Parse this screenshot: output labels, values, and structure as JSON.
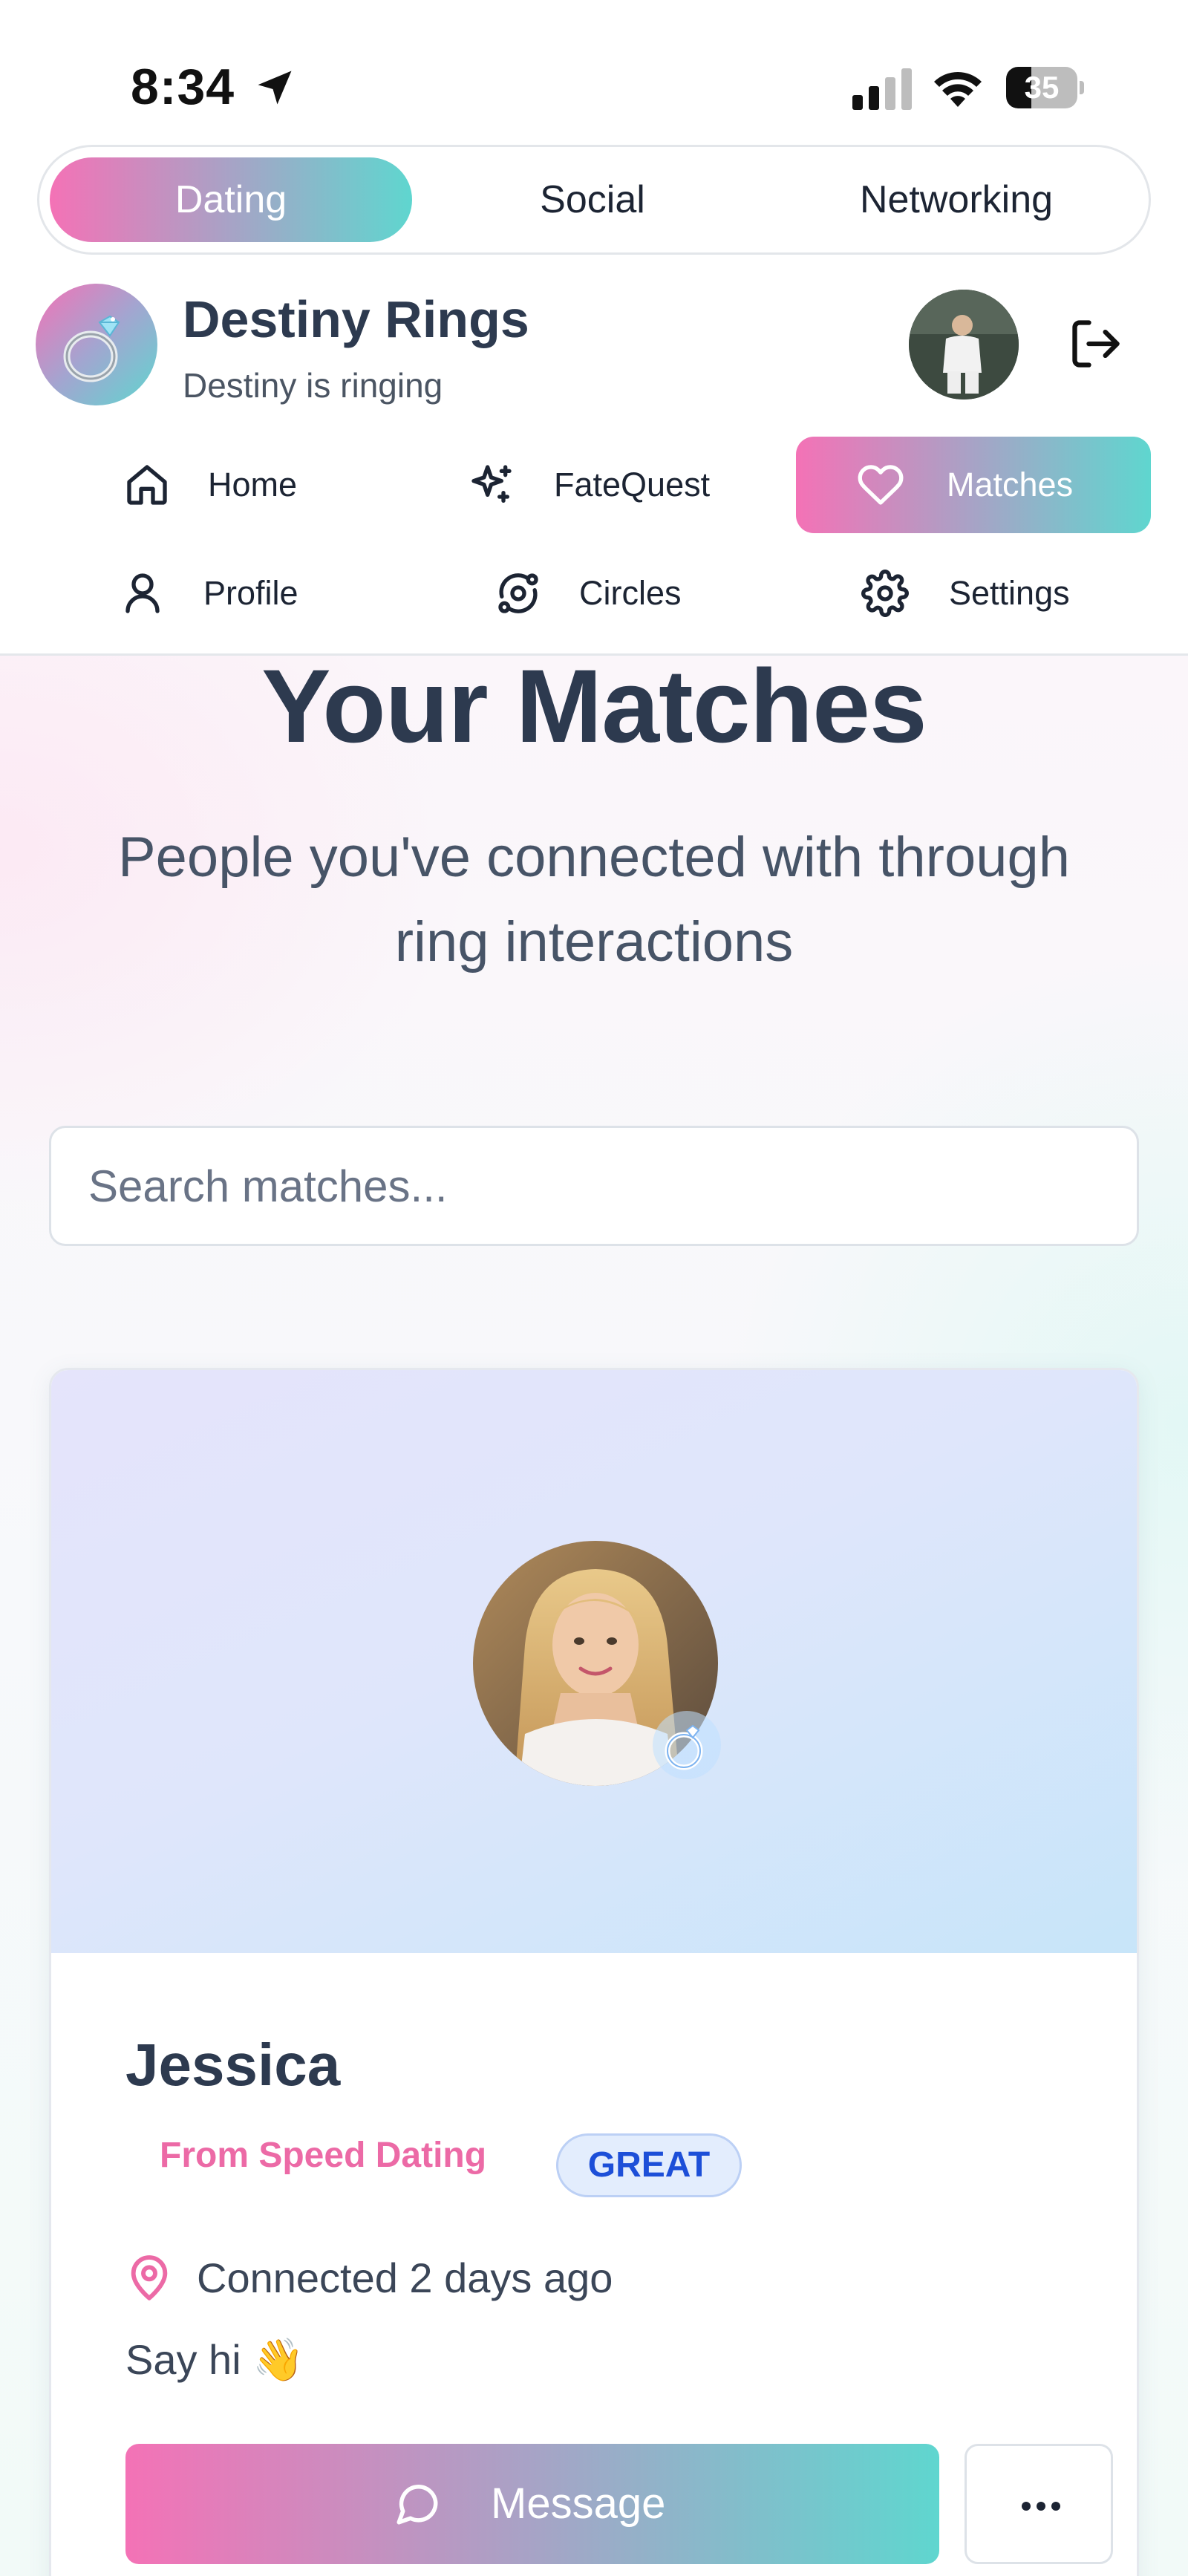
{
  "status_bar": {
    "time": "8:34",
    "battery": "35",
    "battery_level": 0.35
  },
  "mode_tabs": [
    {
      "label": "Dating",
      "active": true
    },
    {
      "label": "Social",
      "active": false
    },
    {
      "label": "Networking",
      "active": false
    }
  ],
  "app": {
    "title": "Destiny Rings",
    "subtitle": "Destiny is ringing",
    "logo_icon": "ring-icon",
    "logout_icon": "logout-icon"
  },
  "nav": [
    {
      "label": "Home",
      "icon": "home-icon",
      "active": false
    },
    {
      "label": "FateQuest",
      "icon": "sparkles-icon",
      "active": false
    },
    {
      "label": "Matches",
      "icon": "heart-icon",
      "active": true
    },
    {
      "label": "Profile",
      "icon": "user-icon",
      "active": false
    },
    {
      "label": "Circles",
      "icon": "orbit-icon",
      "active": false
    },
    {
      "label": "Settings",
      "icon": "gear-icon",
      "active": false
    }
  ],
  "page": {
    "title": "Your Matches",
    "subtitle": "People you've connected with through ring interactions"
  },
  "search": {
    "placeholder": "Search matches...",
    "value": ""
  },
  "matches": [
    {
      "name": "Jessica",
      "source": "From Speed Dating",
      "quality": "GREAT",
      "connected": "Connected 2 days ago",
      "greeting": "Say hi 👋",
      "message_label": "Message",
      "more_icon": "more-horizontal-icon"
    }
  ],
  "colors": {
    "gradient_start": "#f472b6",
    "gradient_end": "#5fd6cf",
    "text_primary": "#2d3a4f",
    "source_pink": "#ec6aa6",
    "badge_blue": "#1d4fd8"
  }
}
